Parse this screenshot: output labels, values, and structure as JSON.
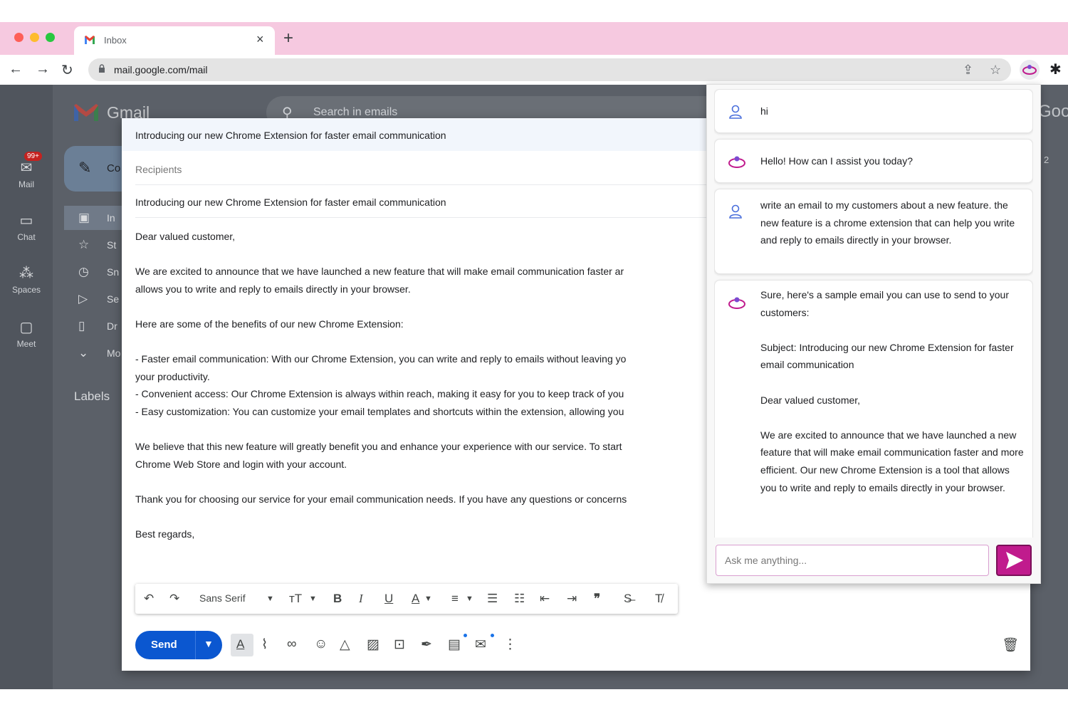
{
  "browser": {
    "tab_title": "Inbox",
    "new_tab_label": "+",
    "close_label": "×",
    "url": "mail.google.com/mail",
    "accent": "#f6c9e0"
  },
  "gmail": {
    "brand": "Gmail",
    "search_placeholder": "Search in emails",
    "compose_label": "Co",
    "unread_badge": "99+",
    "rail": [
      {
        "label": "Mail",
        "icon": "mail-icon"
      },
      {
        "label": "Chat",
        "icon": "chat-icon"
      },
      {
        "label": "Spaces",
        "icon": "spaces-icon"
      },
      {
        "label": "Meet",
        "icon": "meet-icon"
      }
    ],
    "nav": [
      {
        "label": "In",
        "icon": "inbox-icon"
      },
      {
        "label": "St",
        "icon": "star-icon"
      },
      {
        "label": "Sn",
        "icon": "clock-icon"
      },
      {
        "label": "Se",
        "icon": "send-icon"
      },
      {
        "label": "Dr",
        "icon": "draft-icon"
      },
      {
        "label": "Mo",
        "icon": "chevron-down-icon"
      }
    ],
    "labels_heading": "Labels",
    "right_logo_fragment": "Goo",
    "right_count": "2"
  },
  "compose": {
    "window_title": "Introducing our new Chrome Extension for faster email communication",
    "recipients_placeholder": "Recipients",
    "subject": "Introducing our new Chrome Extension for faster email communication",
    "body": "Dear valued customer,\n\nWe are excited to announce that we have launched a new feature that will make email communication faster ar\nallows you to write and reply to emails directly in your browser.\n\nHere are some of the benefits of our new Chrome Extension:\n\n- Faster email communication: With our Chrome Extension, you can write and reply to emails without leaving yo\nyour productivity.\n- Convenient access: Our Chrome Extension is always within reach, making it easy for you to keep track of you\n- Easy customization: You can customize your email templates and shortcuts within the extension, allowing you\n\nWe believe that this new feature will greatly benefit you and enhance your experience with our service. To start\nChrome Web Store and login with your account.\n\nThank you for choosing our service for your email communication needs. If you have any questions or concerns\n\nBest regards,",
    "font_name": "Sans Serif",
    "send_label": "Send"
  },
  "assistant": {
    "accent": "#c01b8d",
    "messages": [
      {
        "role": "user",
        "text": "hi"
      },
      {
        "role": "assistant",
        "text": "Hello! How can I assist you today?"
      },
      {
        "role": "user",
        "text": "write an email to my customers about a new feature. the new feature is a chrome extension that can help you write and reply to emails directly in your browser."
      },
      {
        "role": "assistant",
        "text": "Sure, here's a sample email you can use to send to your customers:\n\nSubject: Introducing our new Chrome Extension for faster email communication\n\nDear valued customer,\n\nWe are excited to announce that we have launched a new feature that will make email communication faster and more efficient. Our new Chrome Extension is a tool that allows you to write and reply to emails directly in your browser."
      }
    ],
    "input_placeholder": "Ask me anything..."
  }
}
